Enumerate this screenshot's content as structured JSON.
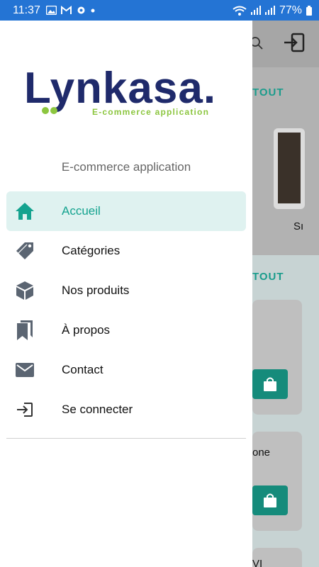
{
  "status_bar": {
    "time": "11:37",
    "battery": "77%",
    "bg_color": "#2474d4"
  },
  "background_app": {
    "see_all_1": "TOUT",
    "see_all_2": "TOUT",
    "product_label": "Sı",
    "card_text": "one",
    "bottom_text": "VI"
  },
  "drawer": {
    "logo_text": "Lynkasa.",
    "logo_tagline": "E-commerce application",
    "subtitle": "E-commerce application",
    "accent_color": "#14a38f",
    "items": [
      {
        "label": "Accueil",
        "icon": "home-icon",
        "active": true
      },
      {
        "label": "Catégories",
        "icon": "tag-icon",
        "active": false
      },
      {
        "label": "Nos produits",
        "icon": "box-icon",
        "active": false
      },
      {
        "label": "À propos",
        "icon": "bookmarks-icon",
        "active": false
      },
      {
        "label": "Contact",
        "icon": "envelope-icon",
        "active": false
      },
      {
        "label": "Se connecter",
        "icon": "login-icon",
        "active": false
      }
    ]
  }
}
